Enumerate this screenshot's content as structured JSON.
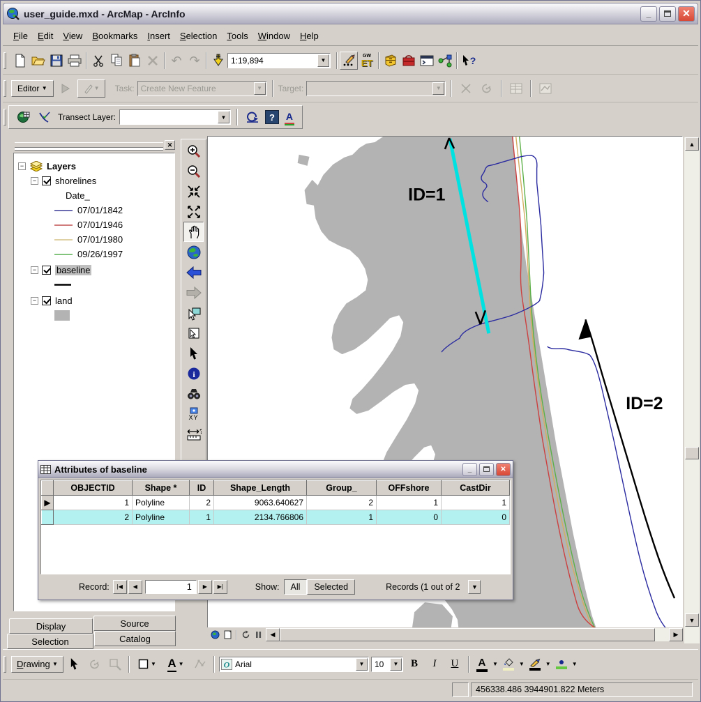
{
  "titlebar": {
    "title": "user_guide.mxd - ArcMap - ArcInfo",
    "buttons": [
      "minimize",
      "maximize",
      "close"
    ]
  },
  "menubar": {
    "items": [
      "File",
      "Edit",
      "View",
      "Bookmarks",
      "Insert",
      "Selection",
      "Tools",
      "Window",
      "Help"
    ]
  },
  "standard_toolbar": {
    "icons": [
      "new",
      "open",
      "save",
      "print",
      "cut",
      "copy",
      "paste",
      "delete",
      "undo",
      "redo",
      "add-data"
    ],
    "scale_value": "1:19,894",
    "right_icons": [
      "editor-sketch",
      "et-geowizards",
      "arccatalog",
      "arctoolbox",
      "command-line",
      "model-builder",
      "whats-this"
    ],
    "et_label": "ET",
    "et_sup": "GW",
    "whats_this_mark": "?"
  },
  "editor_toolbar": {
    "editor_label": "Editor",
    "task_label": "Task:",
    "task_value": "Create New Feature",
    "target_label": "Target:",
    "disabled_icons": [
      "edit-tool",
      "sketch-tool",
      "split-tool",
      "rotate-tool",
      "attributes-table",
      "sketch-properties"
    ]
  },
  "transect_toolbar": {
    "icons": [
      "transect-globe",
      "cast-transects"
    ],
    "layer_label": "Transect Layer:",
    "layer_value": "",
    "right_icons": [
      "recalculate",
      "help",
      "annotate"
    ],
    "help_mark": "?",
    "annotate_label": "A"
  },
  "toc": {
    "root_label": "Layers",
    "shorelines": {
      "label": "shorelines",
      "legend_title": "Date_",
      "items": [
        {
          "label": "07/01/1842",
          "color": "#3A3A99"
        },
        {
          "label": "07/01/1946",
          "color": "#C05050"
        },
        {
          "label": "07/01/1980",
          "color": "#D6C285"
        },
        {
          "label": "09/26/1997",
          "color": "#5AB050"
        }
      ]
    },
    "baseline": {
      "label": "baseline",
      "swatch_color": "#000000",
      "selected": true
    },
    "land": {
      "label": "land",
      "swatch_color": "#B3B3B3"
    }
  },
  "toc_tabs": {
    "display": "Display",
    "source": "Source",
    "selection": "Selection",
    "catalog": "Catalog"
  },
  "tools_toolbar": {
    "icons": [
      "zoom-in",
      "zoom-out",
      "fixed-zoom-in",
      "fixed-zoom-out",
      "pan",
      "full-extent",
      "go-back",
      "go-forward",
      "select-features",
      "clear-selected-features",
      "select-elements",
      "identify",
      "find",
      "go-to-xy",
      "measure"
    ],
    "active_tool": "pan",
    "xy_label": "XY",
    "identify_mark": "i",
    "measure_mark": "?"
  },
  "map": {
    "labels": {
      "transect1": "ID=1",
      "transect2": "ID=2"
    },
    "colors": {
      "land": "#B3B3B3",
      "selection_cyan": "#00E2E2",
      "shoreline_1842": "#2A2AA0",
      "shoreline_1946": "#CC4040",
      "shoreline_1980": "#D4AE62",
      "shoreline_1997": "#5DB048",
      "baseline_black": "#000000"
    },
    "minibar_icons": [
      "data-view",
      "layout-view",
      "refresh",
      "pause"
    ]
  },
  "attribute_dialog": {
    "title": "Attributes of baseline",
    "columns": [
      "OBJECTID",
      "Shape *",
      "ID",
      "Shape_Length",
      "Group_",
      "OFFshore",
      "CastDir"
    ],
    "rows": [
      {
        "cells": [
          "1",
          "Polyline",
          "2",
          "9063.640627",
          "2",
          "1",
          "1"
        ],
        "selected": false
      },
      {
        "cells": [
          "2",
          "Polyline",
          "1",
          "2134.766806",
          "1",
          "0",
          "0"
        ],
        "selected": true
      }
    ],
    "record_bar": {
      "record_label": "Record:",
      "value": "1",
      "show_label": "Show:",
      "all_label": "All",
      "selected_label": "Selected",
      "records_text": "Records (1 out of 2"
    }
  },
  "drawing_toolbar": {
    "drawing_label": "Drawing",
    "icons": [
      "select-elements",
      "rotate",
      "zoom-to-selected",
      "rectangle-tool",
      "text-tool",
      "edit-vertices"
    ],
    "font_value": "Arial",
    "font_icon": "O",
    "size_value": "10",
    "bold_label": "B",
    "italic_label": "I",
    "underline_label": "U",
    "text_tool_label": "A",
    "font_color_label": "A",
    "color_buttons": [
      "font-color",
      "fill-color",
      "line-color",
      "marker-color"
    ],
    "fill_color_swatch": "#F0EFC2",
    "line_color_swatch": "#000000",
    "marker_color_swatch": "#66C840",
    "font_color_swatch": "#000000"
  },
  "statusbar": {
    "coordinates": "456338.486 3944901.822 Meters"
  }
}
